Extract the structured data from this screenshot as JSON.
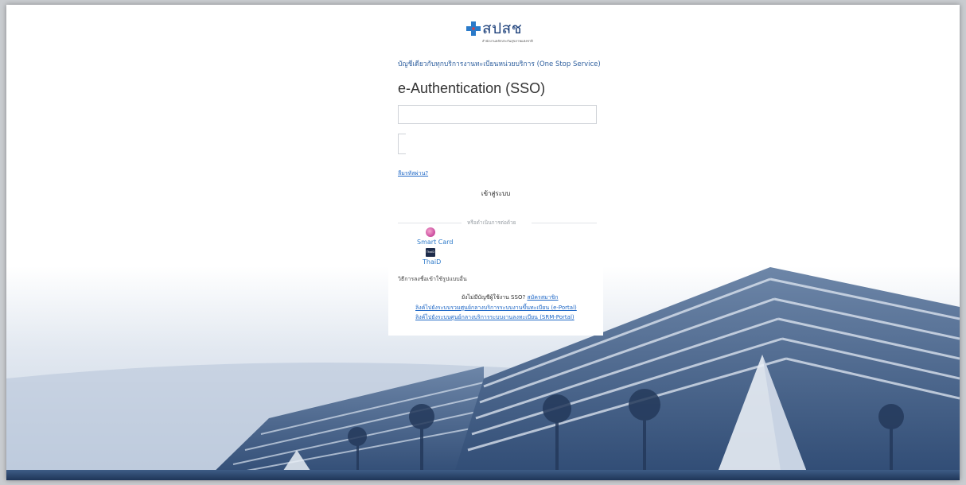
{
  "logo": {
    "text": "สปสช",
    "subtext": "สำนักงานหลักประกันสุขภาพแห่งชาติ"
  },
  "header": {
    "subtitle": "บัญชีเดียวกับทุกบริการงานทะเบียนหน่วยบริการ (One Stop Service)",
    "title": "e-Authentication (SSO)"
  },
  "form": {
    "username_value": "",
    "password_value": "",
    "forgot_password": "ลืมรหัสผ่าน?",
    "login_label": "เข้าสู่ระบบ"
  },
  "alt_login": {
    "divider_text": "หรือดำเนินการต่อด้วย",
    "smartcard_label": "Smart Card",
    "thaid_icon_text": "ThaiD",
    "thaid_label": "ThaiD",
    "other_methods": "วิธีการลงชื่อเข้าใช้รูปแบบอื่น"
  },
  "footer": {
    "no_account": "ยังไม่มีบัญชีผู้ใช้งาน SSO?",
    "register": "สมัครสมาชิก",
    "eportal_link": "ลิงค์ไปยังระบบรวมศูนย์กลางบริการระบบงานขึ้นทะเบียน (e-Portal)",
    "srm_link": "ลิงค์ไปยังระบบศูนย์กลางบริการระบบงานลงทะเบียน (SRM-Portal)"
  },
  "colors": {
    "brand_blue": "#1b3f7a",
    "link_blue": "#1e67c6",
    "scene_blue": "#3c5f8e"
  },
  "icons": {
    "logo": "nhso-cross-logo",
    "smartcard": "smart-card-icon",
    "thaid": "thaid-icon"
  }
}
